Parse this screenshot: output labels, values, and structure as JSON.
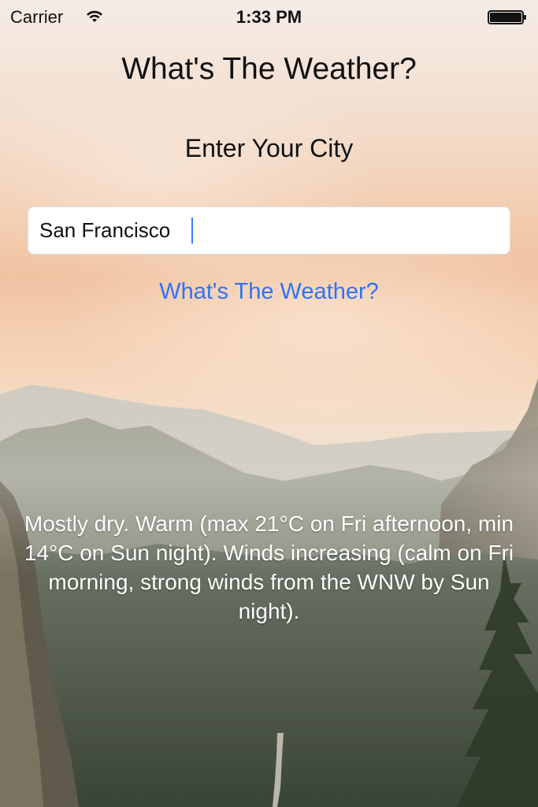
{
  "status_bar": {
    "carrier": "Carrier",
    "time": "1:33 PM",
    "wifi_icon": "wifi-icon",
    "battery_icon": "battery-icon"
  },
  "app": {
    "title": "What's The Weather?",
    "subtitle": "Enter Your City",
    "city_input": {
      "value": "San Francisco",
      "placeholder": ""
    },
    "submit_button_label": "What's The Weather?",
    "forecast_text": "Mostly dry. Warm (max 21°C on Fri afternoon, min 14°C on Sun night). Winds increasing (calm on Fri morning, strong winds from the WNW by Sun night)."
  },
  "colors": {
    "button_text": "#2f73f5",
    "forecast_text": "#ffffff"
  }
}
